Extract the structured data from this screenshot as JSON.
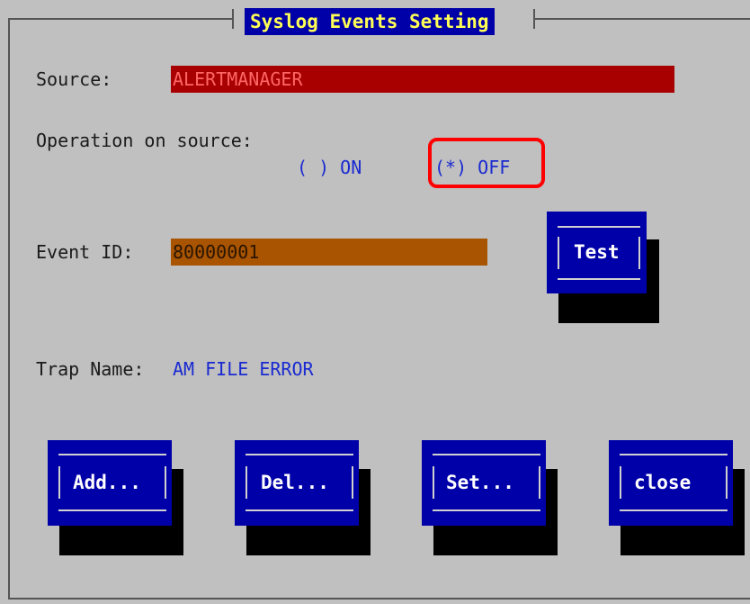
{
  "dialog": {
    "title": "Syslog Events Setting"
  },
  "source": {
    "label": "Source:",
    "value": "ALERTMANAGER"
  },
  "operation": {
    "label": "Operation on source:",
    "on_option": "( ) ON",
    "off_option": "(*) OFF",
    "selected": "OFF"
  },
  "event": {
    "label": "Event ID:",
    "value": "80000001"
  },
  "trap": {
    "label": "Trap Name:",
    "value": "AM FILE ERROR"
  },
  "buttons": {
    "test": "Test",
    "add": "Add...",
    "del": "Del...",
    "set": "Set...",
    "close": "close"
  },
  "colors": {
    "background": "#c0c0c0",
    "button_blue": "#0000a8",
    "title_text": "#ffff55",
    "source_field": "#a80000",
    "event_field": "#a85400",
    "option_text": "#1a2ad0",
    "highlight": "#ff0000"
  }
}
